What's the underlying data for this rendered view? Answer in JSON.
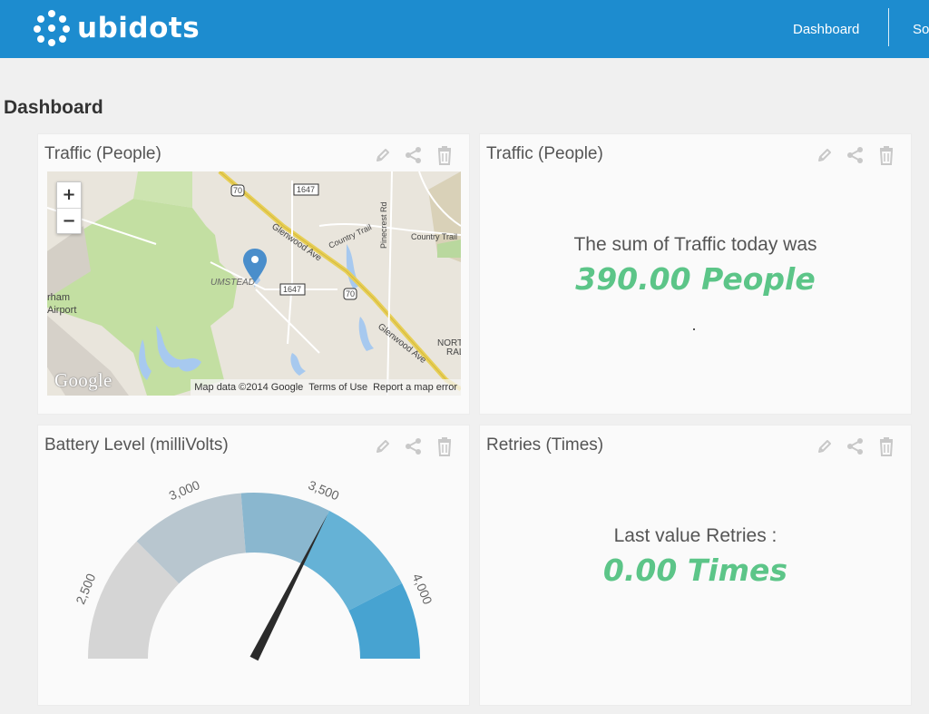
{
  "header": {
    "brand": "ubidots",
    "nav": [
      "Dashboard",
      "So"
    ]
  },
  "page": {
    "title": "Dashboard"
  },
  "widgets": [
    {
      "title": "Traffic (People)",
      "type": "map",
      "map": {
        "zoom_in": "+",
        "zoom_out": "−",
        "labels": [
          "70",
          "1647",
          "Glenwood Ave",
          "Country Trail",
          "Pinecrest Rd",
          "Country Trail",
          "UMSTEAD",
          "1647",
          "70",
          "rham",
          "Airport",
          "Glenwood Ave",
          "NORT",
          "RAL"
        ],
        "google": "Google",
        "attribution": [
          "Map data ©2014 Google",
          "Terms of Use",
          "Report a map error"
        ]
      }
    },
    {
      "title": "Traffic (People)",
      "type": "stat",
      "label": "The sum of Traffic today was",
      "value": "390.00 People"
    },
    {
      "title": "Battery Level (milliVolts)",
      "type": "gauge",
      "gauge": {
        "min": 2250,
        "max": 4250,
        "value": 3550,
        "ticks": [
          {
            "label": "2,500",
            "value": 2500
          },
          {
            "label": "3,000",
            "value": 3000
          },
          {
            "label": "3,500",
            "value": 3500
          },
          {
            "label": "4,000",
            "value": 4000
          }
        ],
        "bands": [
          {
            "from": 2250,
            "to": 2750,
            "color": "#d5d5d5"
          },
          {
            "from": 2750,
            "to": 3200,
            "color": "#b8c6cf"
          },
          {
            "from": 3200,
            "to": 3550,
            "color": "#8ab7cf"
          },
          {
            "from": 3550,
            "to": 3950,
            "color": "#65b2d6"
          },
          {
            "from": 3950,
            "to": 4250,
            "color": "#47a3d1"
          }
        ]
      }
    },
    {
      "title": "Retries (Times)",
      "type": "stat",
      "label": "Last value Retries :",
      "value": "0.00 Times"
    }
  ],
  "tools": [
    "pencil-icon",
    "share-icon",
    "trash-icon"
  ],
  "colors": {
    "header": "#1d8ccf",
    "value": "#5cc588",
    "icon": "#c8c8c8"
  }
}
